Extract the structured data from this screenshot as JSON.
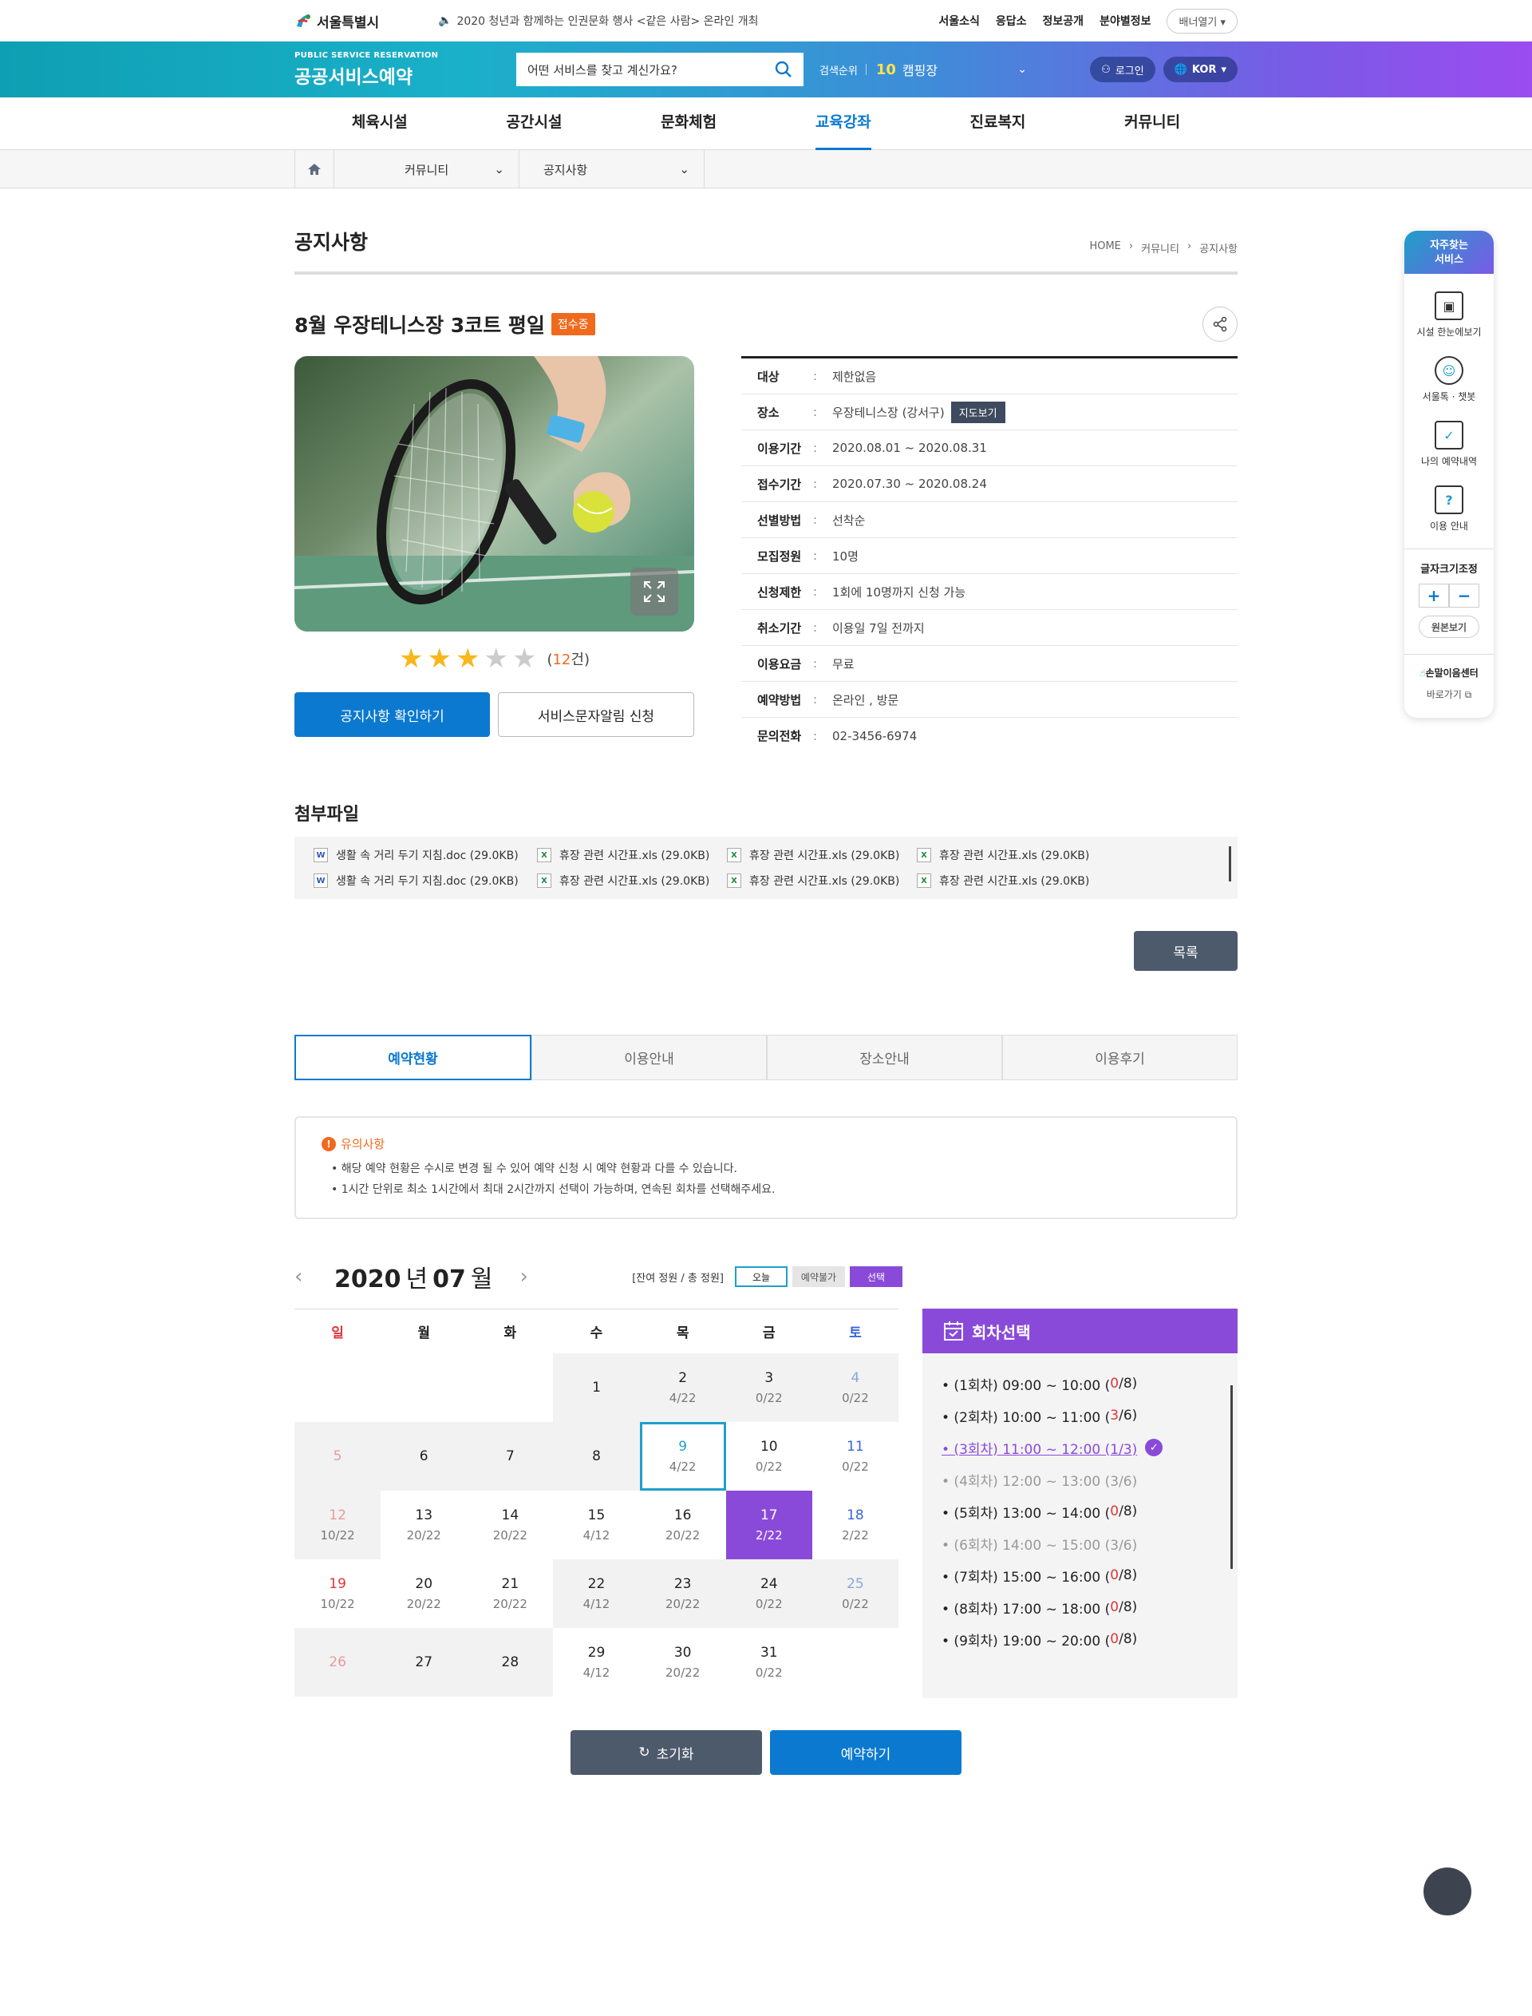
{
  "topbar": {
    "logo": "서울특별시",
    "notice": "2020 청년과 함께하는 인권문화 행사 <같은 사람> 온라인 개최",
    "links": [
      "서울소식",
      "응답소",
      "정보공개",
      "분야별정보"
    ],
    "banner_btn": "배너열기"
  },
  "header": {
    "brand_en": "PUBLIC SERVICE RESERVATION",
    "brand_ko": "공공서비스예약",
    "search_placeholder": "어떤 서비스를 찾고 계신가요?",
    "rank_label": "검색순위",
    "rank_no": "10",
    "rank_term": "캠핑장",
    "login": "로그인",
    "lang": "KOR"
  },
  "gnb": [
    "체육시설",
    "공간시설",
    "문화체험",
    "교육강좌",
    "진료복지",
    "커뮤니티"
  ],
  "gnb_active": "교육강좌",
  "location": {
    "sel1": "커뮤니티",
    "sel2": "공지사항"
  },
  "page": {
    "title": "공지사항",
    "breadcrumb": [
      "HOME",
      "커뮤니티",
      "공지사항"
    ]
  },
  "detail": {
    "title": "8월 우장테니스장 3코트 평일",
    "badge": "접수중",
    "rating": 3,
    "rating_max": 5,
    "review_count": "12",
    "review_suffix": "건",
    "btn_confirm": "공지사항 확인하기",
    "btn_sms": "서비스문자알림 신청",
    "map_btn": "지도보기",
    "info": [
      {
        "k": "대상",
        "v": "제한없음"
      },
      {
        "k": "장소",
        "v": "우장테니스장 (강서구)"
      },
      {
        "k": "이용기간",
        "v": "2020.08.01 ~ 2020.08.31"
      },
      {
        "k": "접수기간",
        "v": "2020.07.30 ~ 2020.08.24"
      },
      {
        "k": "선별방법",
        "v": "선착순"
      },
      {
        "k": "모집정원",
        "v": "10명"
      },
      {
        "k": "신청제한",
        "v": "1회에 10명까지 신청 가능"
      },
      {
        "k": "취소기간",
        "v": "이용일 7일 전까지"
      },
      {
        "k": "이용요금",
        "v": "무료"
      },
      {
        "k": "예약방법",
        "v": "온라인 , 방문"
      },
      {
        "k": "문의전화",
        "v": "02-3456-6974"
      }
    ]
  },
  "attachments": {
    "title": "첨부파일",
    "files": [
      {
        "type": "W",
        "name": "생활 속 거리 두기 지침.doc (29.0KB)"
      },
      {
        "type": "X",
        "name": "휴장 관련 시간표.xls (29.0KB)"
      },
      {
        "type": "X",
        "name": "휴장 관련 시간표.xls (29.0KB)"
      },
      {
        "type": "X",
        "name": "휴장 관련 시간표.xls (29.0KB)"
      },
      {
        "type": "W",
        "name": "생활 속 거리 두기 지침.doc (29.0KB)"
      },
      {
        "type": "X",
        "name": "휴장 관련 시간표.xls (29.0KB)"
      },
      {
        "type": "X",
        "name": "휴장 관련 시간표.xls (29.0KB)"
      },
      {
        "type": "X",
        "name": "휴장 관련 시간표.xls (29.0KB)"
      }
    ],
    "list_btn": "목록"
  },
  "tabs": [
    "예약현황",
    "이용안내",
    "장소안내",
    "이용후기"
  ],
  "notes": {
    "title": "유의사항",
    "items": [
      "• 해당 예약 현황은 수시로 변경 될 수 있어 예약 신청 시 예약 현황과 다를 수 있습니다.",
      "• 1시간 단위로 최소 1시간에서 최대 2시간까지 선택이 가능하며, 연속된 회차를 선택해주세요."
    ]
  },
  "calendar": {
    "year": "2020",
    "year_suffix": "년",
    "month": "07",
    "month_suffix": "월",
    "legend_label": "[잔여 정원 / 총 정원]",
    "legend": [
      "오늘",
      "예약불가",
      "선택"
    ],
    "dow": [
      "일",
      "월",
      "화",
      "수",
      "목",
      "금",
      "토"
    ],
    "cells": [
      {
        "d": "",
        "s": "",
        "st": ""
      },
      {
        "d": "",
        "s": "",
        "st": ""
      },
      {
        "d": "",
        "s": "",
        "st": ""
      },
      {
        "d": "1",
        "s": "",
        "st": "g"
      },
      {
        "d": "2",
        "s": "4/22",
        "st": "g"
      },
      {
        "d": "3",
        "s": "0/22",
        "st": "g"
      },
      {
        "d": "4",
        "s": "0/22",
        "st": "g"
      },
      {
        "d": "5",
        "s": "",
        "st": "g"
      },
      {
        "d": "6",
        "s": "",
        "st": "g"
      },
      {
        "d": "7",
        "s": "",
        "st": "g"
      },
      {
        "d": "8",
        "s": "",
        "st": "g"
      },
      {
        "d": "9",
        "s": "4/22",
        "st": "today"
      },
      {
        "d": "10",
        "s": "0/22",
        "st": ""
      },
      {
        "d": "11",
        "s": "0/22",
        "st": ""
      },
      {
        "d": "12",
        "s": "10/22",
        "st": "g"
      },
      {
        "d": "13",
        "s": "20/22",
        "st": ""
      },
      {
        "d": "14",
        "s": "20/22",
        "st": ""
      },
      {
        "d": "15",
        "s": "4/12",
        "st": ""
      },
      {
        "d": "16",
        "s": "20/22",
        "st": ""
      },
      {
        "d": "17",
        "s": "2/22",
        "st": "sel"
      },
      {
        "d": "18",
        "s": "2/22",
        "st": ""
      },
      {
        "d": "19",
        "s": "10/22",
        "st": ""
      },
      {
        "d": "20",
        "s": "20/22",
        "st": ""
      },
      {
        "d": "21",
        "s": "20/22",
        "st": ""
      },
      {
        "d": "22",
        "s": "4/12",
        "st": "g"
      },
      {
        "d": "23",
        "s": "20/22",
        "st": "g"
      },
      {
        "d": "24",
        "s": "0/22",
        "st": "g"
      },
      {
        "d": "25",
        "s": "0/22",
        "st": "g"
      },
      {
        "d": "26",
        "s": "",
        "st": "g"
      },
      {
        "d": "27",
        "s": "",
        "st": "g"
      },
      {
        "d": "28",
        "s": "",
        "st": "g"
      },
      {
        "d": "29",
        "s": "4/12",
        "st": ""
      },
      {
        "d": "30",
        "s": "20/22",
        "st": ""
      },
      {
        "d": "31",
        "s": "0/22",
        "st": ""
      },
      {
        "d": "",
        "s": "",
        "st": ""
      }
    ]
  },
  "rounds": {
    "title": "회차선택",
    "items": [
      {
        "pre": "• (1회차) 09:00 ~ 10:00 (",
        "r": "0",
        "post": "/8)",
        "st": ""
      },
      {
        "pre": "• (2회차) 10:00 ~ 11:00 (",
        "r": "3",
        "post": "/6)",
        "st": ""
      },
      {
        "pre": "• (3회차) 11:00 ~ 12:00 (1/3)",
        "r": "",
        "post": "",
        "st": "sel"
      },
      {
        "pre": "• (4회차) 12:00 ~ 13:00 (3/6)",
        "r": "",
        "post": "",
        "st": "dis"
      },
      {
        "pre": "• (5회차) 13:00 ~ 14:00 (",
        "r": "0",
        "post": "/8)",
        "st": ""
      },
      {
        "pre": "• (6회차) 14:00 ~ 15:00 (3/6)",
        "r": "",
        "post": "",
        "st": "dis"
      },
      {
        "pre": "• (7회차) 15:00 ~ 16:00 (",
        "r": "0",
        "post": "/8)",
        "st": ""
      },
      {
        "pre": "• (8회차) 17:00 ~ 18:00 (",
        "r": "0",
        "post": "/8)",
        "st": ""
      },
      {
        "pre": "• (9회차) 19:00 ~ 20:00 (",
        "r": "0",
        "post": "/8)",
        "st": ""
      }
    ]
  },
  "actions": {
    "reset": "초기화",
    "book": "예약하기"
  },
  "quick": {
    "title_line1": "자주찾는",
    "title_line2": "서비스",
    "items": [
      "시설 한눈에보기",
      "서울톡 · 챗봇",
      "나의 예약내역",
      "이용 안내"
    ],
    "font_title": "글자크기조정",
    "plus": "+",
    "minus": "−",
    "orig": "원본보기",
    "sign_title": "손말이음센터",
    "sign_go": "바로가기"
  }
}
